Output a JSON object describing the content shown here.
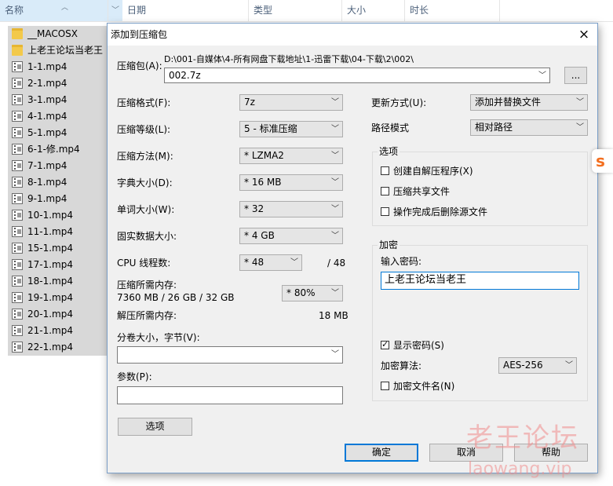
{
  "explorer": {
    "columns": [
      "名称",
      "日期",
      "类型",
      "大小",
      "时长"
    ],
    "files": [
      {
        "name": "__MACOSX",
        "type": "folder"
      },
      {
        "name": "上老王论坛当老王",
        "type": "folder"
      },
      {
        "name": "1-1.mp4",
        "type": "video"
      },
      {
        "name": "2-1.mp4",
        "type": "video"
      },
      {
        "name": "3-1.mp4",
        "type": "video"
      },
      {
        "name": "4-1.mp4",
        "type": "video"
      },
      {
        "name": "5-1.mp4",
        "type": "video"
      },
      {
        "name": "6-1-修.mp4",
        "type": "video"
      },
      {
        "name": "7-1.mp4",
        "type": "video"
      },
      {
        "name": "8-1.mp4",
        "type": "video"
      },
      {
        "name": "9-1.mp4",
        "type": "video"
      },
      {
        "name": "10-1.mp4",
        "type": "video"
      },
      {
        "name": "11-1.mp4",
        "type": "video"
      },
      {
        "name": "15-1.mp4",
        "type": "video"
      },
      {
        "name": "17-1.mp4",
        "type": "video"
      },
      {
        "name": "18-1.mp4",
        "type": "video"
      },
      {
        "name": "19-1.mp4",
        "type": "video"
      },
      {
        "name": "20-1.mp4",
        "type": "video"
      },
      {
        "name": "21-1.mp4",
        "type": "video"
      },
      {
        "name": "22-1.mp4",
        "type": "video"
      }
    ]
  },
  "dialog": {
    "title": "添加到压缩包",
    "close_icon": "×",
    "archive": {
      "label": "压缩包(A):",
      "path": "D:\\001-自媒体\\4-所有网盘下载地址\\1-迅雷下载\\04-下载\\2\\002\\",
      "filename": "002.7z",
      "browse": "..."
    },
    "format": {
      "label": "压缩格式(F):",
      "value": "7z"
    },
    "level": {
      "label": "压缩等级(L):",
      "value": "5 - 标准压缩"
    },
    "method": {
      "label": "压缩方法(M):",
      "value": "* LZMA2"
    },
    "dict": {
      "label": "字典大小(D):",
      "value": "* 16 MB"
    },
    "word": {
      "label": "单词大小(W):",
      "value": "* 32"
    },
    "solid": {
      "label": "固实数据大小:",
      "value": "* 4 GB"
    },
    "cpu": {
      "label": "CPU 线程数:",
      "value": "* 48",
      "max": "/ 48"
    },
    "mem_compress": {
      "label": "压缩所需内存:",
      "detail": "7360 MB / 26 GB / 32 GB",
      "value": "* 80%"
    },
    "mem_decompress": {
      "label": "解压所需内存:",
      "value": "18 MB"
    },
    "split": {
      "label": "分卷大小，字节(V):",
      "value": ""
    },
    "params": {
      "label": "参数(P):",
      "value": ""
    },
    "update": {
      "label": "更新方式(U):",
      "value": "添加并替换文件"
    },
    "pathmode": {
      "label": "路径模式",
      "value": "相对路径"
    },
    "options": {
      "legend": "选项",
      "sfx": "创建自解压程序(X)",
      "shared": "压缩共享文件",
      "delete": "操作完成后删除源文件"
    },
    "encryption": {
      "legend": "加密",
      "pw_label": "输入密码:",
      "password": "上老王论坛当老王",
      "show_pw": "显示密码(S)",
      "alg_label": "加密算法:",
      "alg_value": "AES-256",
      "encrypt_names": "加密文件名(N)"
    },
    "buttons": {
      "options": "选项",
      "ok": "确定",
      "cancel": "取消",
      "help": "帮助"
    }
  },
  "watermark": {
    "cn": "老王论坛",
    "en": "laowang.vip"
  }
}
